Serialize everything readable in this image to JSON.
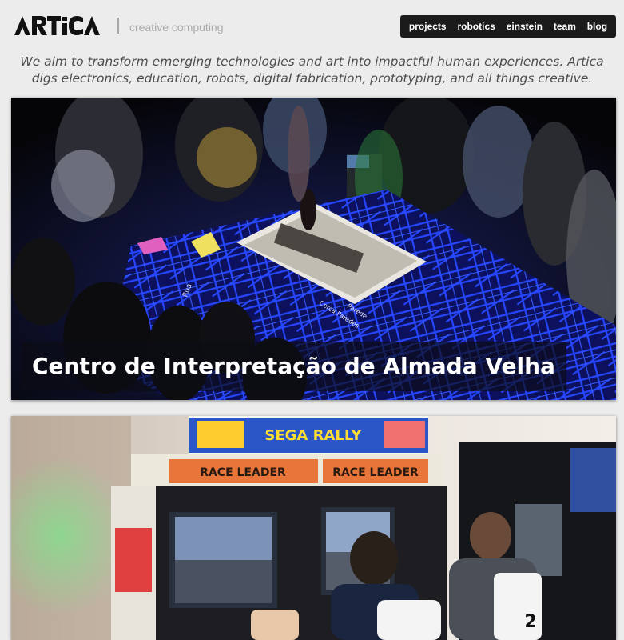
{
  "header": {
    "logo_text": "ARTICA",
    "tagline": "creative computing"
  },
  "nav": {
    "items": [
      {
        "label": "projects"
      },
      {
        "label": "robotics"
      },
      {
        "label": "einstein"
      },
      {
        "label": "team"
      },
      {
        "label": "blog"
      }
    ]
  },
  "intro": {
    "text": "We aim to transform emerging technologies and art into impactful human experiences. Artica digs electronics, education, robots, digital fabrication, prototyping, and all things creative."
  },
  "projects": [
    {
      "title": "Centro de Interpretação de Almada Velha",
      "map_labels": [
        "Rua",
        "Cerca Paredes",
        "Parede"
      ]
    },
    {
      "title": "",
      "marquee": "SEGA RALLY",
      "banners": [
        "RACE LEADER",
        "RACE LEADER"
      ],
      "seat_number": "2"
    }
  ],
  "colors": {
    "background": "#ececec",
    "nav_background": "#1b1b1b",
    "map_blue": "#1e3cff"
  }
}
